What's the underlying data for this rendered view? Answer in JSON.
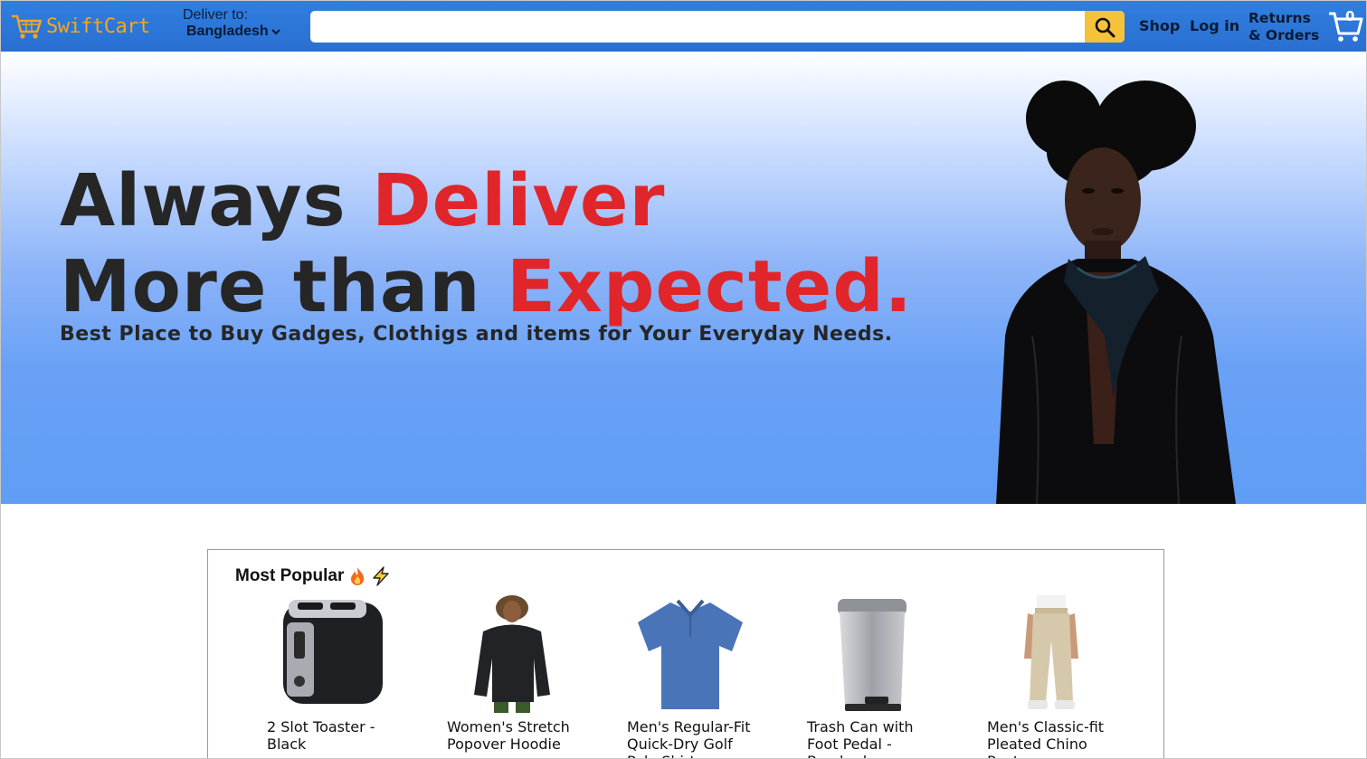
{
  "nav": {
    "logo_text": "SwiftCart",
    "deliver_label": "Deliver to:",
    "deliver_country": "Bangladesh",
    "search_placeholder": "",
    "links": {
      "shop": "Shop",
      "login": "Log in",
      "returns_line1": "Returns",
      "returns_line2": "& Orders"
    },
    "cart_count": "0",
    "colors": {
      "bar": "#2a6fd1",
      "logo": "#f5a623",
      "search_button": "#f6c23a"
    }
  },
  "hero": {
    "line1_plain": "Always ",
    "line1_accent": "Deliver",
    "line2_plain": "More than ",
    "line2_accent": "Expected.",
    "subtitle": "Best Place to Buy Gadges, Clothigs and items for Your Everyday Needs.",
    "colors": {
      "accent": "#e0262a",
      "text": "#262626"
    }
  },
  "popular": {
    "title": "Most Popular",
    "title_emojis": [
      "fire-icon",
      "lightning-icon"
    ],
    "products": [
      {
        "name": "2 Slot Toaster - Black",
        "icon": "toaster-image"
      },
      {
        "name": "Women's Stretch Popover Hoodie",
        "icon": "hoodie-image"
      },
      {
        "name": "Men's Regular-Fit Quick-Dry Golf Polo Shirt",
        "icon": "polo-shirt-image"
      },
      {
        "name": "Trash Can with Foot Pedal - Brushed",
        "icon": "trash-can-image"
      },
      {
        "name": "Men's Classic-fit Pleated Chino Pants",
        "icon": "chino-pants-image"
      }
    ]
  }
}
